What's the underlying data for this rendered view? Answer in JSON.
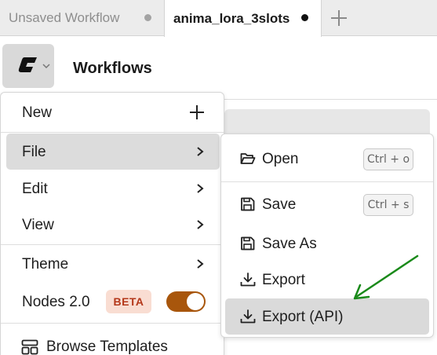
{
  "tabs": [
    {
      "label": "Unsaved Workflow",
      "modified": true,
      "active": false
    },
    {
      "label": "anima_lora_3slots",
      "modified": true,
      "active": true
    }
  ],
  "header": {
    "title": "Workflows",
    "logo_icon": "comfy-logo-icon"
  },
  "menu": {
    "new_label": "New",
    "file_label": "File",
    "edit_label": "Edit",
    "view_label": "View",
    "theme_label": "Theme",
    "nodes_label": "Nodes 2.0",
    "beta_badge": "BETA",
    "nodes_enabled": true,
    "browse_label": "Browse Templates"
  },
  "file_submenu": {
    "open_label": "Open",
    "open_shortcut": "Ctrl + o",
    "save_label": "Save",
    "save_shortcut": "Ctrl + s",
    "save_as_label": "Save As",
    "export_label": "Export",
    "export_api_label": "Export (API)"
  },
  "colors": {
    "accent_toggle": "#a8560c",
    "beta_bg": "#f9ddd2",
    "beta_text": "#b4381a",
    "annotation_arrow": "#1a8a1a"
  }
}
